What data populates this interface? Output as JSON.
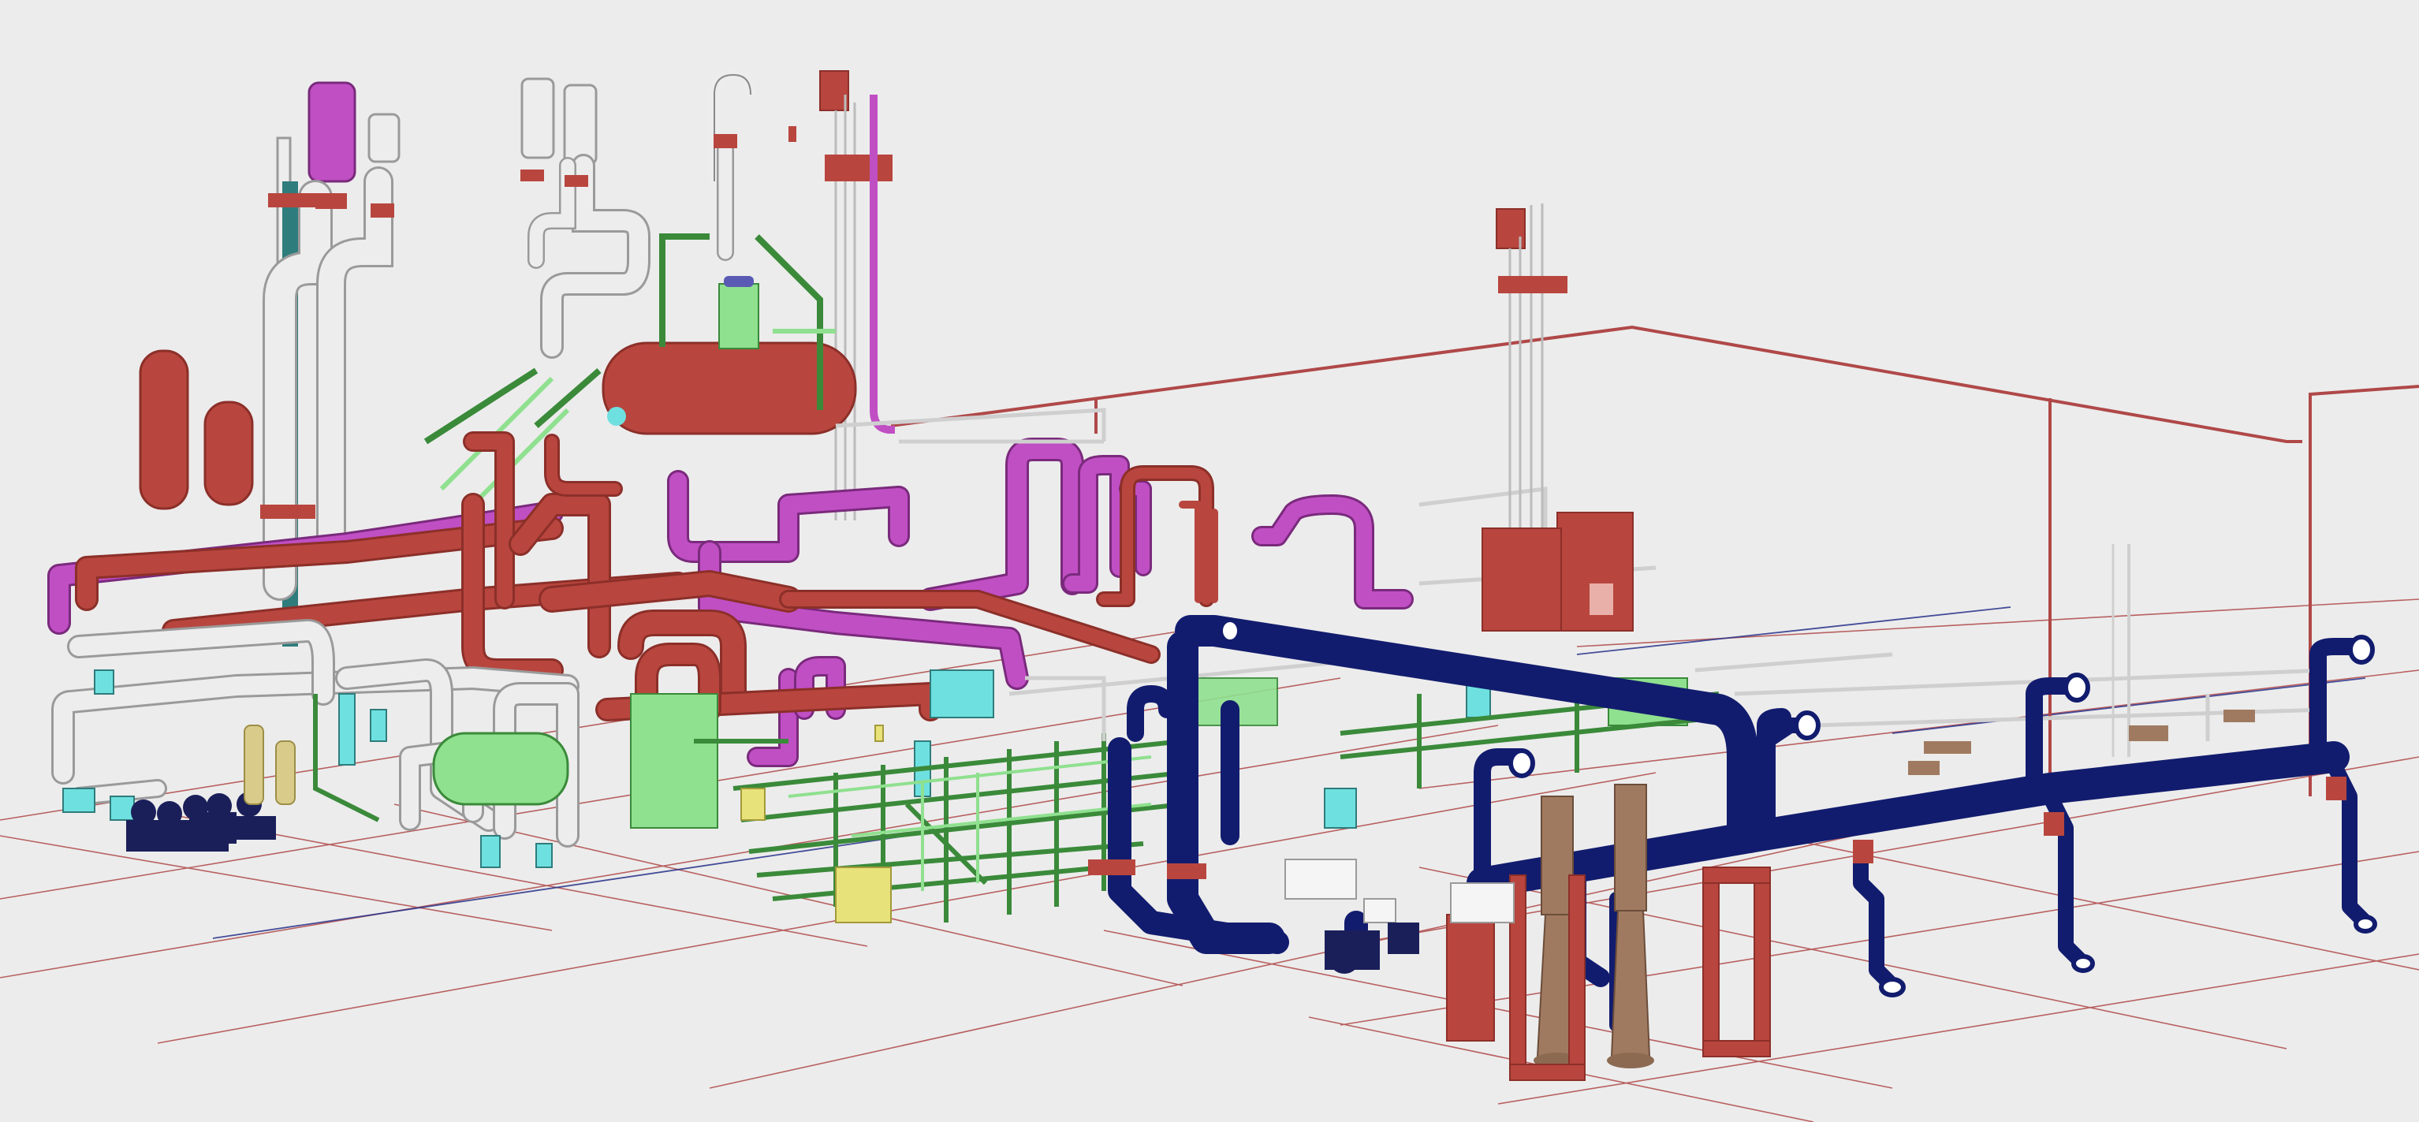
{
  "viewport": {
    "background": "#ececec",
    "colors": {
      "grid_red": "#b04848",
      "grid_blue": "#27318a",
      "pipe_red": "#b8463e",
      "pipe_red_dark": "#8c2f29",
      "pipe_magenta": "#c04fc4",
      "pipe_white": "#ededed",
      "pipe_white_edge": "#9a9a9a",
      "pipe_navy": "#121c6e",
      "pipe_green": "#3a8a3a",
      "pipe_lightgreen": "#8fe08f",
      "pipe_teal": "#2f7c7c",
      "pipe_cyan": "#6fe0e0",
      "pipe_yellow": "#e8e27a",
      "pump_navy": "#1a1f5a",
      "pump_bronze": "#a07a60",
      "tank_beige": "#d9cc8a"
    }
  }
}
